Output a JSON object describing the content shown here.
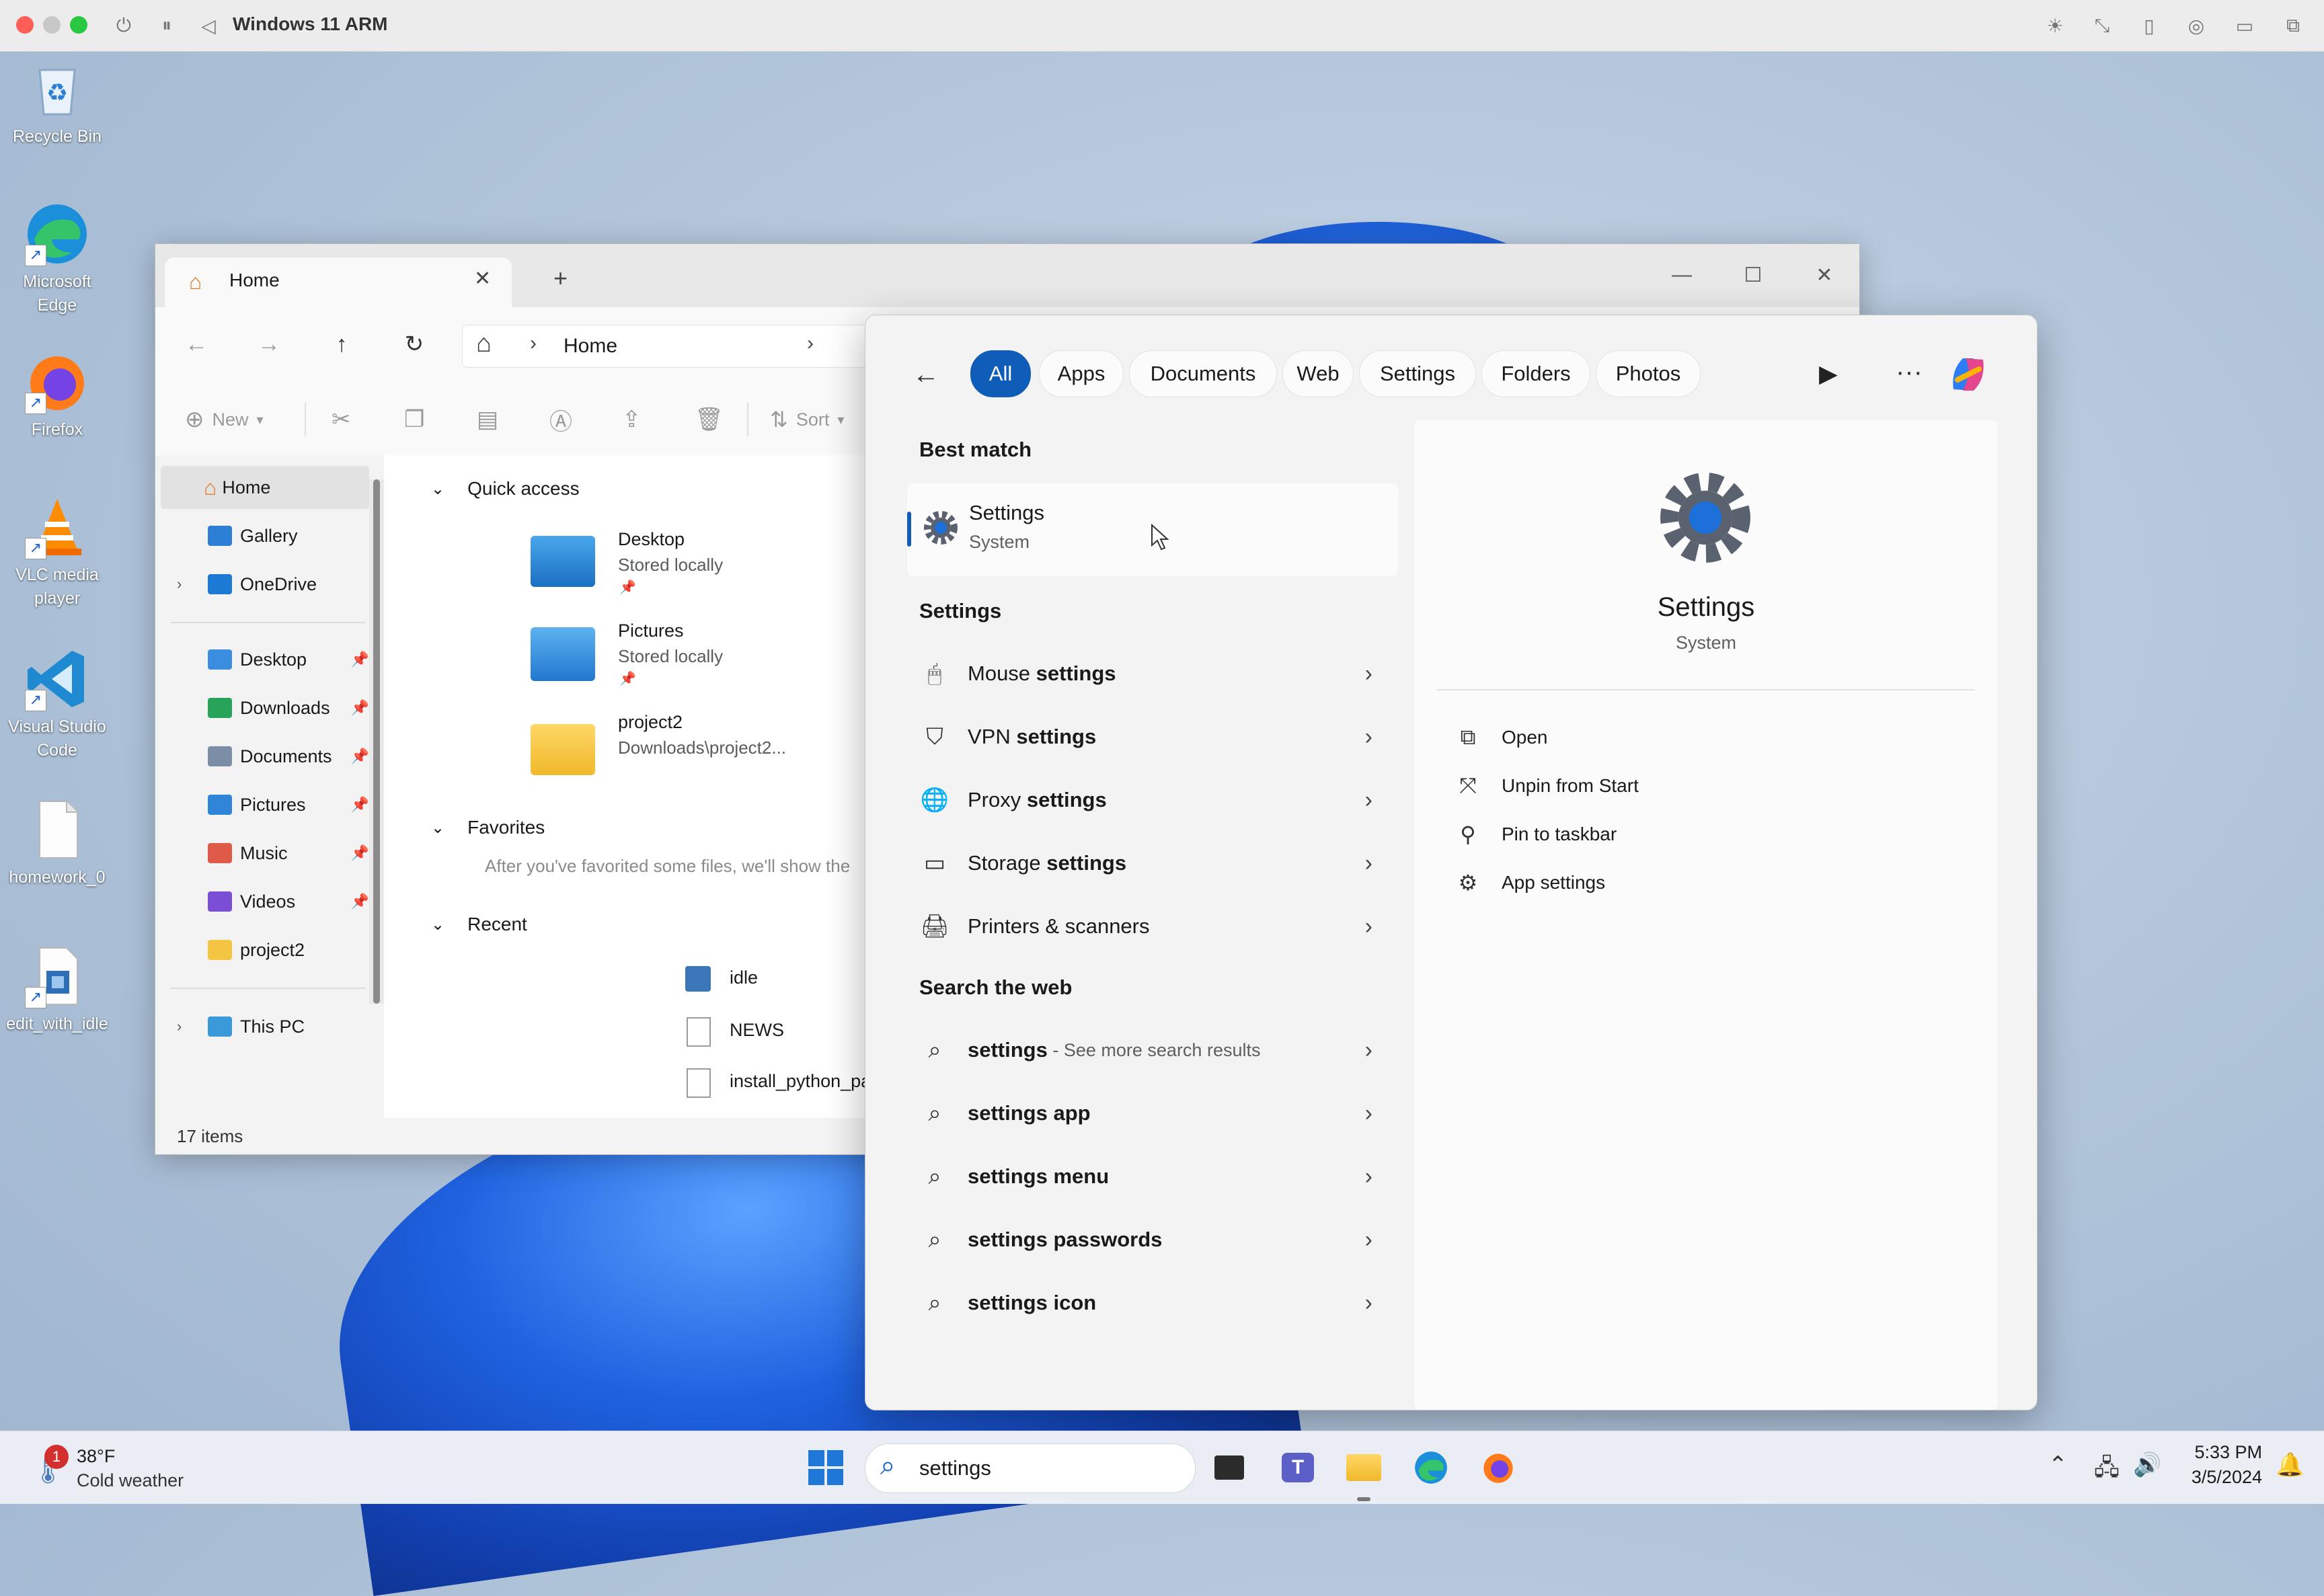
{
  "vm": {
    "title": "Windows 11 ARM"
  },
  "desktop": {
    "icons": [
      {
        "label": "Recycle Bin"
      },
      {
        "label": "Microsoft Edge"
      },
      {
        "label": "Firefox"
      },
      {
        "label": "VLC media player"
      },
      {
        "label": "Visual Studio Code"
      },
      {
        "label": "homework_0"
      },
      {
        "label": "edit_with_idle"
      }
    ]
  },
  "explorer": {
    "tab_title": "Home",
    "breadcrumb": "Home",
    "commands": {
      "new": "New",
      "sort": "Sort"
    },
    "nav": {
      "home": "Home",
      "gallery": "Gallery",
      "onedrive": "OneDrive",
      "pinned": [
        "Desktop",
        "Downloads",
        "Documents",
        "Pictures",
        "Music",
        "Videos",
        "project2"
      ],
      "this_pc": "This PC"
    },
    "quick_access": {
      "title": "Quick access",
      "items": [
        {
          "name": "Desktop",
          "sub": "Stored locally"
        },
        {
          "name": "Pictures",
          "sub": "Stored locally"
        },
        {
          "name": "project2",
          "sub": "Downloads\\project2..."
        }
      ]
    },
    "favorites": {
      "title": "Favorites",
      "empty_text": "After you've favorited some files, we'll show the"
    },
    "recent": {
      "title": "Recent",
      "items": [
        "idle",
        "NEWS",
        "install_python_packages"
      ]
    },
    "status": "17 items"
  },
  "search": {
    "filters": [
      "All",
      "Apps",
      "Documents",
      "Web",
      "Settings",
      "Folders",
      "Photos"
    ],
    "active_filter": "All",
    "best_match_title": "Best match",
    "best_match": {
      "name": "Settings",
      "type": "System"
    },
    "settings_title": "Settings",
    "settings_results": [
      {
        "pre": "Mouse ",
        "bold": "settings",
        "icon": "mouse-icon"
      },
      {
        "pre": "VPN ",
        "bold": "settings",
        "icon": "shield-icon"
      },
      {
        "pre": "Proxy ",
        "bold": "settings",
        "icon": "globe-icon"
      },
      {
        "pre": "Storage ",
        "bold": "settings",
        "icon": "storage-icon"
      },
      {
        "pre": "Printers & scanners",
        "bold": "",
        "icon": "printer-icon"
      }
    ],
    "web_title": "Search the web",
    "web_results": [
      {
        "bold": "settings",
        "rest": "",
        "extra": " - See more search results"
      },
      {
        "bold": "settings",
        "rest": " app",
        "extra": ""
      },
      {
        "bold": "settings",
        "rest": " menu",
        "extra": ""
      },
      {
        "bold": "settings",
        "rest": " passwords",
        "extra": ""
      },
      {
        "bold": "settings",
        "rest": " icon",
        "extra": ""
      }
    ],
    "detail": {
      "name": "Settings",
      "type": "System",
      "actions": [
        "Open",
        "Unpin from Start",
        "Pin to taskbar",
        "App settings"
      ]
    }
  },
  "taskbar": {
    "weather": {
      "temp": "38°F",
      "desc": "Cold weather",
      "badge": "1"
    },
    "search_value": "settings",
    "time": "5:33 PM",
    "date": "3/5/2024"
  },
  "colors": {
    "accent": "#0f5db8",
    "desktop": "#b3c6db"
  }
}
